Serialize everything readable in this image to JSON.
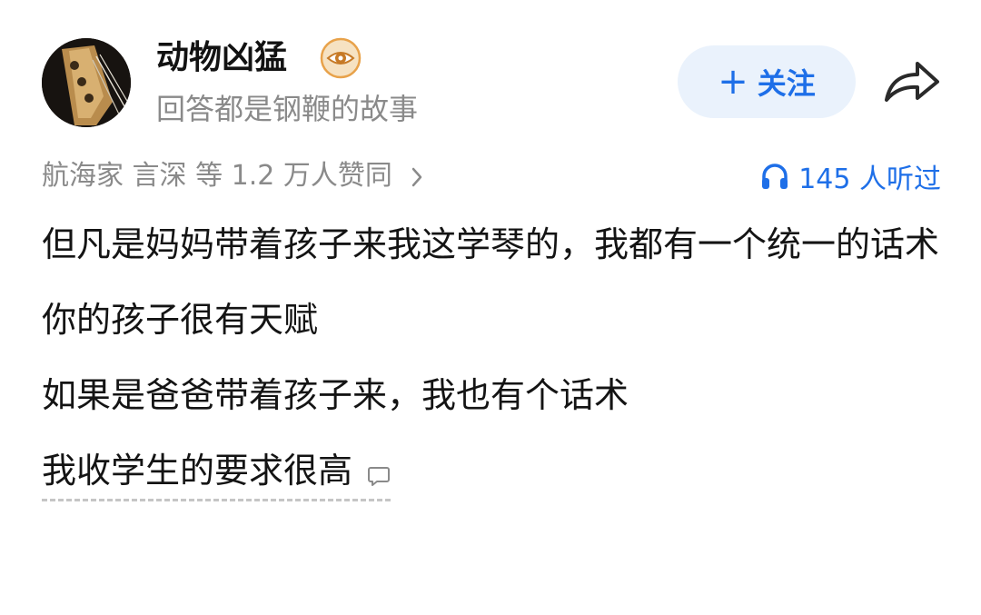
{
  "author": {
    "name": "动物凶猛",
    "bio": "回答都是钢鞭的故事",
    "badge_icon": "eye-badge-icon",
    "avatar_icon": "guitar-avatar"
  },
  "actions": {
    "follow_plus": "+",
    "follow_label": "关注",
    "share_icon": "share-arrow-icon"
  },
  "meta": {
    "upvote_summary": "航海家 言深 等 1.2 万人赞同",
    "listen_count": "145 人听过"
  },
  "content": {
    "paragraphs": [
      "但凡是妈妈带着孩子来我这学琴的，我都有一个统一的话术",
      "你的孩子很有天赋",
      "如果是爸爸带着孩子来，我也有个话术",
      "我收学生的要求很高"
    ]
  },
  "colors": {
    "accent": "#1e6fe8",
    "follow_bg": "#eaf2fc",
    "muted_text": "#8a8a8a",
    "badge_orange": "#e8a24a"
  }
}
